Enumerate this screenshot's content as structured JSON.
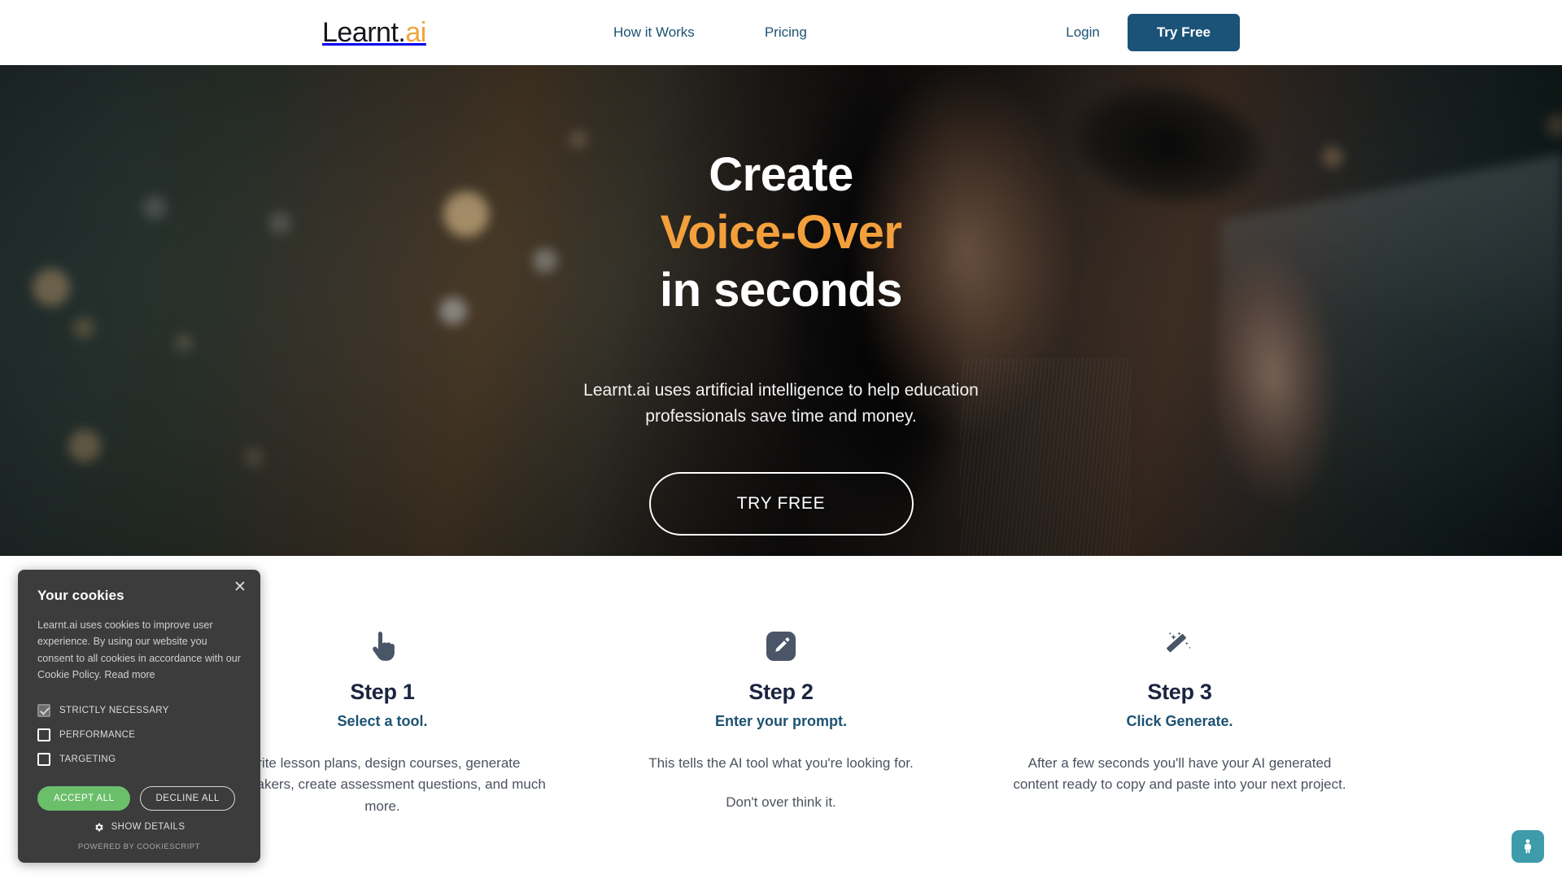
{
  "header": {
    "logo": {
      "main": "Learnt",
      "dot": ".",
      "accent": "ai"
    },
    "nav": [
      {
        "label": "How it Works"
      },
      {
        "label": "Pricing"
      }
    ],
    "login_label": "Login",
    "try_free_label": "Try Free"
  },
  "hero": {
    "title_line1": "Create",
    "title_line2": "Voice-Over",
    "title_line3": "in seconds",
    "subtitle": "Learnt.ai uses artificial intelligence to help education professionals save time and money.",
    "cta_label": "TRY FREE",
    "accent_color": "#F3A03C"
  },
  "steps": [
    {
      "icon": "pointing-hand-icon",
      "title": "Step 1",
      "subtitle": "Select a tool.",
      "body1": "Write lesson plans, design courses, generate icebreakers, create assessment questions, and much more.",
      "body2": ""
    },
    {
      "icon": "pencil-edit-icon",
      "title": "Step 2",
      "subtitle": "Enter your prompt.",
      "body1": "This tells the AI tool what you're looking for.",
      "body2": "Don't over think it."
    },
    {
      "icon": "magic-wand-icon",
      "title": "Step 3",
      "subtitle": "Click Generate.",
      "body1": "After a few seconds you'll have your AI generated content ready to copy and paste into your next project.",
      "body2": ""
    }
  ],
  "cookie_dialog": {
    "title": "Your cookies",
    "body": "Learnt.ai uses cookies to improve user experience. By using our website you consent to all cookies in accordance with our Cookie Policy.",
    "read_more_label": "Read more",
    "options": [
      {
        "label": "STRICTLY NECESSARY",
        "checked": true,
        "disabled": true
      },
      {
        "label": "PERFORMANCE",
        "checked": false,
        "disabled": false
      },
      {
        "label": "TARGETING",
        "checked": false,
        "disabled": false
      }
    ],
    "accept_label": "ACCEPT ALL",
    "decline_label": "DECLINE ALL",
    "show_details_label": "SHOW DETAILS",
    "powered_by": "POWERED BY COOKIESCRIPT",
    "close_glyph": "✕",
    "accent_color": "#6BBF6B",
    "background_color": "#3C3C3C"
  },
  "accessibility_widget": {
    "icon": "accessibility-person-icon",
    "color": "#3D9BAA"
  }
}
